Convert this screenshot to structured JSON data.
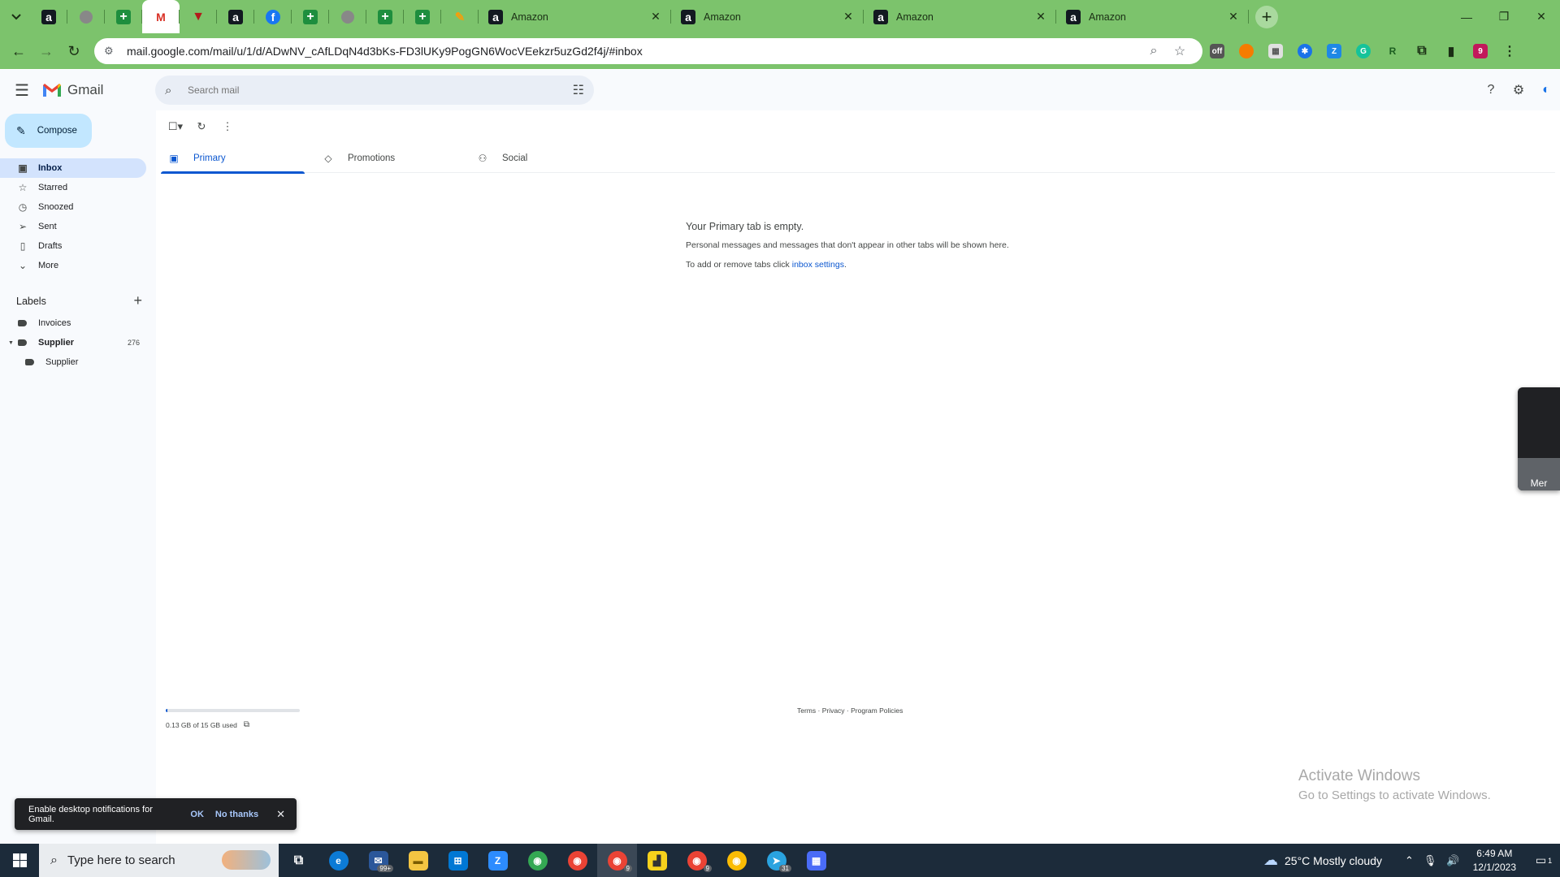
{
  "browser": {
    "tabs": [
      {
        "title": "Amazon"
      },
      {
        "title": "Amazon"
      },
      {
        "title": "Amazon"
      },
      {
        "title": "Amazon"
      }
    ],
    "url": "mail.google.com/mail/u/1/d/ADwNV_cAfLDqN4d3bKs-FD3lUKy9PogGN6WocVEekzr5uzGd2f4j/#inbox",
    "profile_initial": "9",
    "accent_color": "#7cc36c"
  },
  "gmail": {
    "brand": "Gmail",
    "search_placeholder": "Search mail",
    "compose_label": "Compose",
    "nav": {
      "inbox": "Inbox",
      "starred": "Starred",
      "snoozed": "Snoozed",
      "sent": "Sent",
      "drafts": "Drafts",
      "more": "More"
    },
    "labels_heading": "Labels",
    "labels": {
      "invoices": "Invoices",
      "supplier": "Supplier",
      "supplier_count": "276",
      "supplier_child": "Supplier"
    },
    "tabs": {
      "primary": "Primary",
      "promotions": "Promotions",
      "social": "Social"
    },
    "empty": {
      "heading": "Your Primary tab is empty.",
      "line1": "Personal messages and messages that don't appear in other tabs will be shown here.",
      "line2_prefix": "To add or remove tabs click ",
      "line2_link": "inbox settings",
      "line2_suffix": "."
    },
    "storage": {
      "text": "0.13 GB of 15 GB used",
      "fraction_used": 0.0087
    },
    "footer": "Terms · Privacy · Program Policies",
    "side_panel_label": "Mer",
    "snackbar": {
      "message": "Enable desktop notifications for Gmail.",
      "ok": "OK",
      "no_thanks": "No thanks"
    }
  },
  "watermark": {
    "line1": "Activate Windows",
    "line2": "Go to Settings to activate Windows."
  },
  "taskbar": {
    "search_placeholder": "Type here to search",
    "mail_badge": "99+",
    "chrome_badge_1": "9",
    "chrome_badge_2": "9",
    "telegram_badge": "31",
    "weather": "25°C  Mostly cloudy",
    "time": "6:49 AM",
    "date": "12/1/2023",
    "notification_count": "1"
  }
}
